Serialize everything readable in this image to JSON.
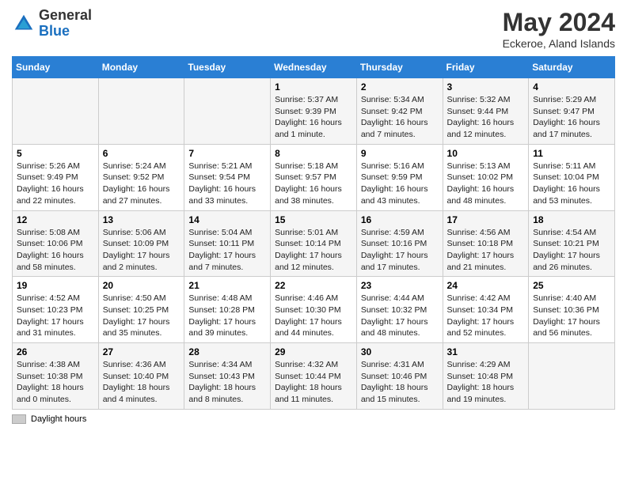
{
  "logo": {
    "general": "General",
    "blue": "Blue"
  },
  "title": {
    "month": "May 2024",
    "location": "Eckeroe, Aland Islands"
  },
  "weekdays": [
    "Sunday",
    "Monday",
    "Tuesday",
    "Wednesday",
    "Thursday",
    "Friday",
    "Saturday"
  ],
  "weeks": [
    [
      {
        "day": "",
        "info": ""
      },
      {
        "day": "",
        "info": ""
      },
      {
        "day": "",
        "info": ""
      },
      {
        "day": "1",
        "info": "Sunrise: 5:37 AM\nSunset: 9:39 PM\nDaylight: 16 hours and 1 minute."
      },
      {
        "day": "2",
        "info": "Sunrise: 5:34 AM\nSunset: 9:42 PM\nDaylight: 16 hours and 7 minutes."
      },
      {
        "day": "3",
        "info": "Sunrise: 5:32 AM\nSunset: 9:44 PM\nDaylight: 16 hours and 12 minutes."
      },
      {
        "day": "4",
        "info": "Sunrise: 5:29 AM\nSunset: 9:47 PM\nDaylight: 16 hours and 17 minutes."
      }
    ],
    [
      {
        "day": "5",
        "info": "Sunrise: 5:26 AM\nSunset: 9:49 PM\nDaylight: 16 hours and 22 minutes."
      },
      {
        "day": "6",
        "info": "Sunrise: 5:24 AM\nSunset: 9:52 PM\nDaylight: 16 hours and 27 minutes."
      },
      {
        "day": "7",
        "info": "Sunrise: 5:21 AM\nSunset: 9:54 PM\nDaylight: 16 hours and 33 minutes."
      },
      {
        "day": "8",
        "info": "Sunrise: 5:18 AM\nSunset: 9:57 PM\nDaylight: 16 hours and 38 minutes."
      },
      {
        "day": "9",
        "info": "Sunrise: 5:16 AM\nSunset: 9:59 PM\nDaylight: 16 hours and 43 minutes."
      },
      {
        "day": "10",
        "info": "Sunrise: 5:13 AM\nSunset: 10:02 PM\nDaylight: 16 hours and 48 minutes."
      },
      {
        "day": "11",
        "info": "Sunrise: 5:11 AM\nSunset: 10:04 PM\nDaylight: 16 hours and 53 minutes."
      }
    ],
    [
      {
        "day": "12",
        "info": "Sunrise: 5:08 AM\nSunset: 10:06 PM\nDaylight: 16 hours and 58 minutes."
      },
      {
        "day": "13",
        "info": "Sunrise: 5:06 AM\nSunset: 10:09 PM\nDaylight: 17 hours and 2 minutes."
      },
      {
        "day": "14",
        "info": "Sunrise: 5:04 AM\nSunset: 10:11 PM\nDaylight: 17 hours and 7 minutes."
      },
      {
        "day": "15",
        "info": "Sunrise: 5:01 AM\nSunset: 10:14 PM\nDaylight: 17 hours and 12 minutes."
      },
      {
        "day": "16",
        "info": "Sunrise: 4:59 AM\nSunset: 10:16 PM\nDaylight: 17 hours and 17 minutes."
      },
      {
        "day": "17",
        "info": "Sunrise: 4:56 AM\nSunset: 10:18 PM\nDaylight: 17 hours and 21 minutes."
      },
      {
        "day": "18",
        "info": "Sunrise: 4:54 AM\nSunset: 10:21 PM\nDaylight: 17 hours and 26 minutes."
      }
    ],
    [
      {
        "day": "19",
        "info": "Sunrise: 4:52 AM\nSunset: 10:23 PM\nDaylight: 17 hours and 31 minutes."
      },
      {
        "day": "20",
        "info": "Sunrise: 4:50 AM\nSunset: 10:25 PM\nDaylight: 17 hours and 35 minutes."
      },
      {
        "day": "21",
        "info": "Sunrise: 4:48 AM\nSunset: 10:28 PM\nDaylight: 17 hours and 39 minutes."
      },
      {
        "day": "22",
        "info": "Sunrise: 4:46 AM\nSunset: 10:30 PM\nDaylight: 17 hours and 44 minutes."
      },
      {
        "day": "23",
        "info": "Sunrise: 4:44 AM\nSunset: 10:32 PM\nDaylight: 17 hours and 48 minutes."
      },
      {
        "day": "24",
        "info": "Sunrise: 4:42 AM\nSunset: 10:34 PM\nDaylight: 17 hours and 52 minutes."
      },
      {
        "day": "25",
        "info": "Sunrise: 4:40 AM\nSunset: 10:36 PM\nDaylight: 17 hours and 56 minutes."
      }
    ],
    [
      {
        "day": "26",
        "info": "Sunrise: 4:38 AM\nSunset: 10:38 PM\nDaylight: 18 hours and 0 minutes."
      },
      {
        "day": "27",
        "info": "Sunrise: 4:36 AM\nSunset: 10:40 PM\nDaylight: 18 hours and 4 minutes."
      },
      {
        "day": "28",
        "info": "Sunrise: 4:34 AM\nSunset: 10:43 PM\nDaylight: 18 hours and 8 minutes."
      },
      {
        "day": "29",
        "info": "Sunrise: 4:32 AM\nSunset: 10:44 PM\nDaylight: 18 hours and 11 minutes."
      },
      {
        "day": "30",
        "info": "Sunrise: 4:31 AM\nSunset: 10:46 PM\nDaylight: 18 hours and 15 minutes."
      },
      {
        "day": "31",
        "info": "Sunrise: 4:29 AM\nSunset: 10:48 PM\nDaylight: 18 hours and 19 minutes."
      },
      {
        "day": "",
        "info": ""
      }
    ]
  ],
  "footer": {
    "legend": "Daylight hours"
  }
}
